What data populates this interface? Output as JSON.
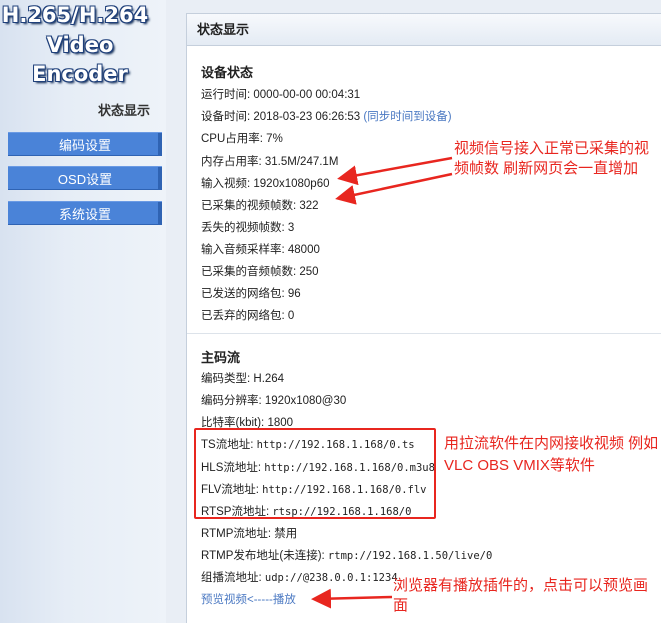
{
  "logo": {
    "line1": "H.265/H.264",
    "line2": "Video Encoder"
  },
  "sidebar": {
    "current": "状态显示",
    "items": [
      {
        "label": "编码设置"
      },
      {
        "label": "OSD设置"
      },
      {
        "label": "系统设置"
      }
    ]
  },
  "panel": {
    "title": "状态显示",
    "device": {
      "title": "设备状态",
      "uptime": "运行时间: 0000-00-00 00:04:31",
      "device_time": "设备时间: 2018-03-23 06:26:53",
      "sync_link": "(同步时间到设备)",
      "cpu": "CPU占用率: 7%",
      "mem": "内存占用率: 31.5M/247.1M",
      "input_video": "输入视频: 1920x1080p60",
      "captured_frames": "已采集的视频帧数: 322",
      "lost_frames": "丢失的视频帧数: 3",
      "audio_rate": "输入音频采样率: 48000",
      "audio_frames": "已采集的音频帧数: 250",
      "sent_packets": "已发送的网络包: 96",
      "dropped_packets": "已丢弃的网络包: 0"
    },
    "stream": {
      "title": "主码流",
      "codec": "编码类型: H.264",
      "resolution": "编码分辨率: 1920x1080@30",
      "bitrate": "比特率(kbit): 1800",
      "ts_label": "TS流地址: ",
      "ts_url": "http://192.168.1.168/0.ts",
      "hls_label": "HLS流地址: ",
      "hls_url": "http://192.168.1.168/0.m3u8",
      "flv_label": "FLV流地址: ",
      "flv_url": "http://192.168.1.168/0.flv",
      "rtsp_label": "RTSP流地址: ",
      "rtsp_url": "rtsp://192.168.1.168/0",
      "rtmp": "RTMP流地址: 禁用",
      "rtmp_publish_label": "RTMP发布地址(未连接): ",
      "rtmp_publish_url": "rtmp://192.168.1.50/live/0",
      "multicast_label": "组播流地址: ",
      "multicast_url": "udp://@238.0.0.1:1234",
      "preview_link": "预览视频<-----播放"
    }
  },
  "annotations": {
    "video_note": "视频信号接入正常已采集的视频帧数 刷新网页会一直增加",
    "stream_note": "用拉流软件在内网接收视频 例如 VLC OBS VMIX等软件",
    "preview_note": "浏览器有播放插件的，点击可以预览画面"
  },
  "colors": {
    "nav_bg": "#4a83d8",
    "annotation": "#e8261f",
    "link": "#4a78c2"
  }
}
